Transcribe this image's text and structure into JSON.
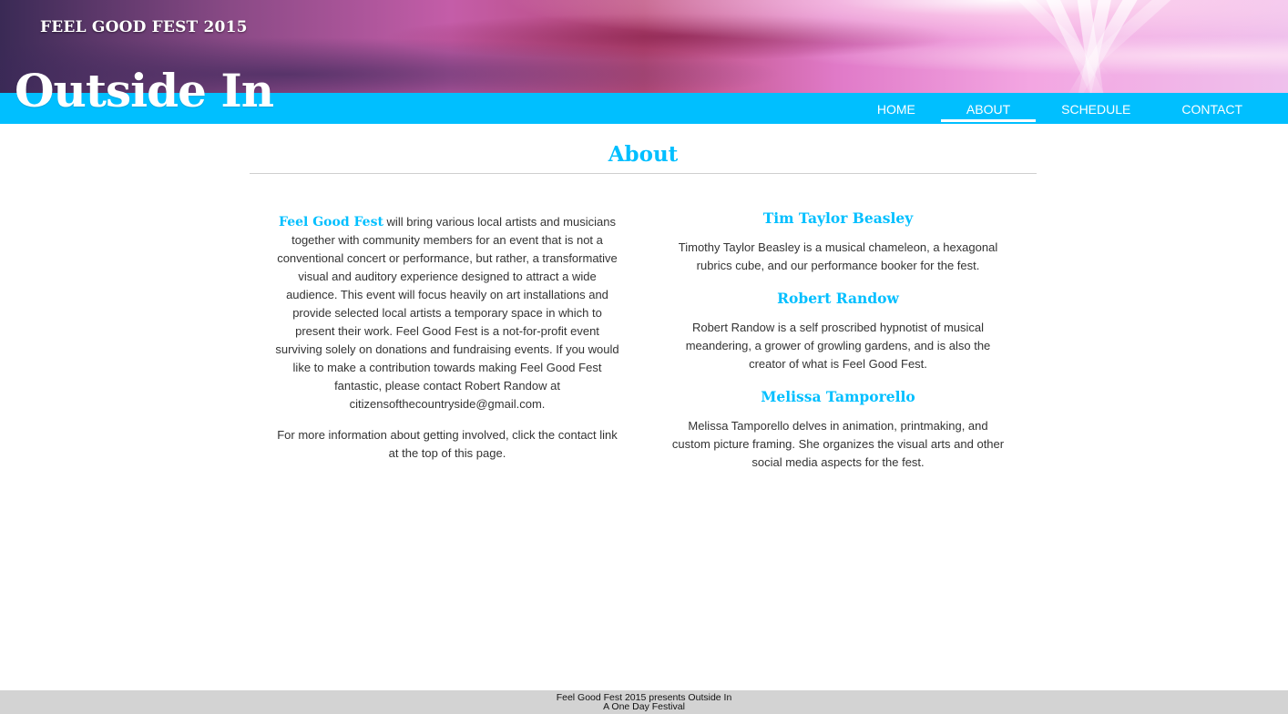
{
  "header": {
    "kicker": "FEEL GOOD FEST 2015",
    "title": "Outside In"
  },
  "nav": {
    "items": [
      {
        "label": "HOME",
        "active": false
      },
      {
        "label": "ABOUT",
        "active": true
      },
      {
        "label": "SCHEDULE",
        "active": false
      },
      {
        "label": "CONTACT",
        "active": false
      }
    ]
  },
  "main": {
    "heading": "About",
    "intro": {
      "brand": "Feel Good Fest",
      "body": "will bring various local artists and musicians together with community members for an event that is not a conventional concert or performance, but rather, a transformative visual and auditory experience designed to attract a wide audience. This event will focus heavily on art installations and provide selected local artists a temporary space in which to present their work. Feel Good Fest is a not-for-profit event surviving solely on donations and fundraising events. If you would like to make a contribution towards making Feel Good Fest fantastic, please contact Robert Randow at citizensofthecountryside@gmail.com.",
      "more": "For more information about getting involved, click the contact link at the top of this page."
    },
    "team": [
      {
        "name": "Tim Taylor Beasley",
        "bio": "Timothy Taylor Beasley is a musical chameleon, a hexagonal rubrics cube, and our performance booker for the fest."
      },
      {
        "name": "Robert Randow",
        "bio": "Robert Randow is a self proscribed hypnotist of musical meandering, a grower of growling gardens, and is also the creator of what is Feel Good Fest."
      },
      {
        "name": "Melissa Tamporello",
        "bio": "Melissa Tamporello delves in animation, printmaking, and custom picture framing. She organizes the visual arts and other social media aspects for the fest."
      }
    ]
  },
  "footer": {
    "line1": "Feel Good Fest 2015 presents Outside In",
    "line2": "A One Day Festival"
  },
  "colors": {
    "accent": "#00bfff",
    "footer_bg": "#d3d3d3",
    "text": "#333333"
  }
}
